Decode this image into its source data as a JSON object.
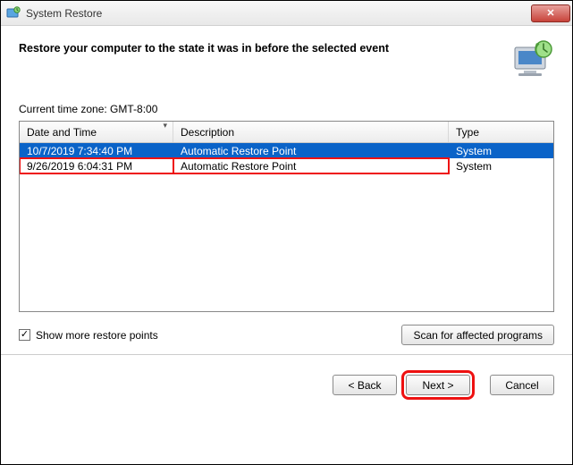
{
  "window": {
    "title": "System Restore"
  },
  "main": {
    "heading": "Restore your computer to the state it was in before the selected event",
    "timezone_label": "Current time zone: GMT-8:00",
    "columns": {
      "datetime": "Date and Time",
      "description": "Description",
      "type": "Type"
    },
    "rows": [
      {
        "datetime": "10/7/2019 7:34:40 PM",
        "description": "Automatic Restore Point",
        "type": "System",
        "selected": true,
        "highlighted": false
      },
      {
        "datetime": "9/26/2019 6:04:31 PM",
        "description": "Automatic Restore Point",
        "type": "System",
        "selected": false,
        "highlighted": true
      }
    ],
    "show_more_label": "Show more restore points",
    "show_more_checked": true,
    "scan_button": "Scan for affected programs"
  },
  "wizard": {
    "back": "< Back",
    "next": "Next >",
    "cancel": "Cancel"
  }
}
